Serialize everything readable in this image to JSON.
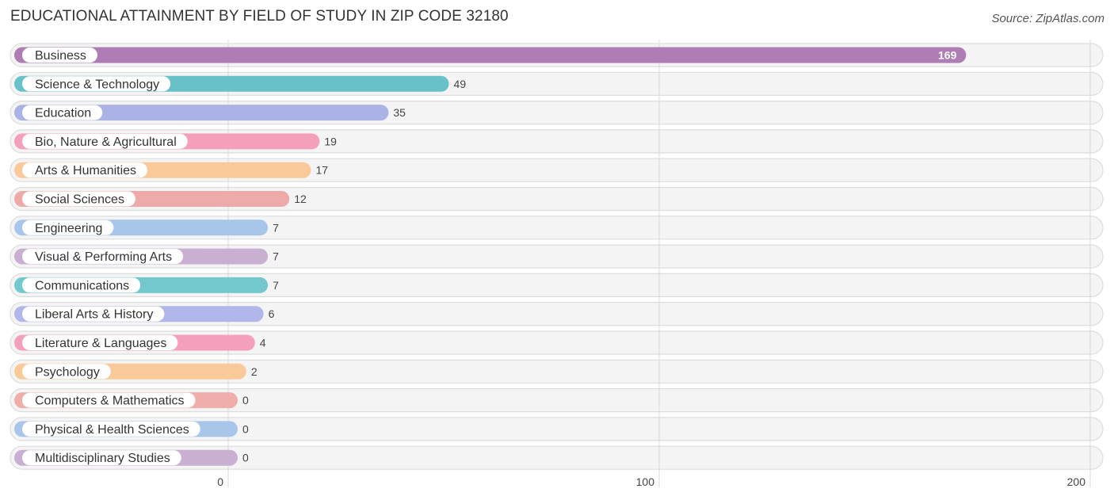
{
  "header": {
    "title": "EDUCATIONAL ATTAINMENT BY FIELD OF STUDY IN ZIP CODE 32180",
    "source": "Source: ZipAtlas.com"
  },
  "chart_data": {
    "type": "bar",
    "orientation": "horizontal",
    "title": "EDUCATIONAL ATTAINMENT BY FIELD OF STUDY IN ZIP CODE 32180",
    "xlabel": "",
    "ylabel": "",
    "xlim": [
      0,
      200
    ],
    "xticks": [
      0,
      100,
      200
    ],
    "grid": true,
    "categories": [
      "Business",
      "Science & Technology",
      "Education",
      "Bio, Nature & Agricultural",
      "Arts & Humanities",
      "Social Sciences",
      "Engineering",
      "Visual & Performing Arts",
      "Communications",
      "Liberal Arts & History",
      "Literature & Languages",
      "Psychology",
      "Computers & Mathematics",
      "Physical & Health Sciences",
      "Multidisciplinary Studies"
    ],
    "values": [
      169,
      49,
      35,
      19,
      17,
      12,
      7,
      7,
      7,
      6,
      4,
      2,
      0,
      0,
      0
    ],
    "colors": [
      "#ad7db3",
      "#68c1c9",
      "#aab2e6",
      "#f5a0bb",
      "#f9c999",
      "#eeaaa8",
      "#a8c6ea",
      "#c9afd2",
      "#72c8cc",
      "#b1b7ea",
      "#f4a0bc",
      "#f9c999",
      "#f0aeab",
      "#a8c6ea",
      "#c9afd2"
    ]
  }
}
